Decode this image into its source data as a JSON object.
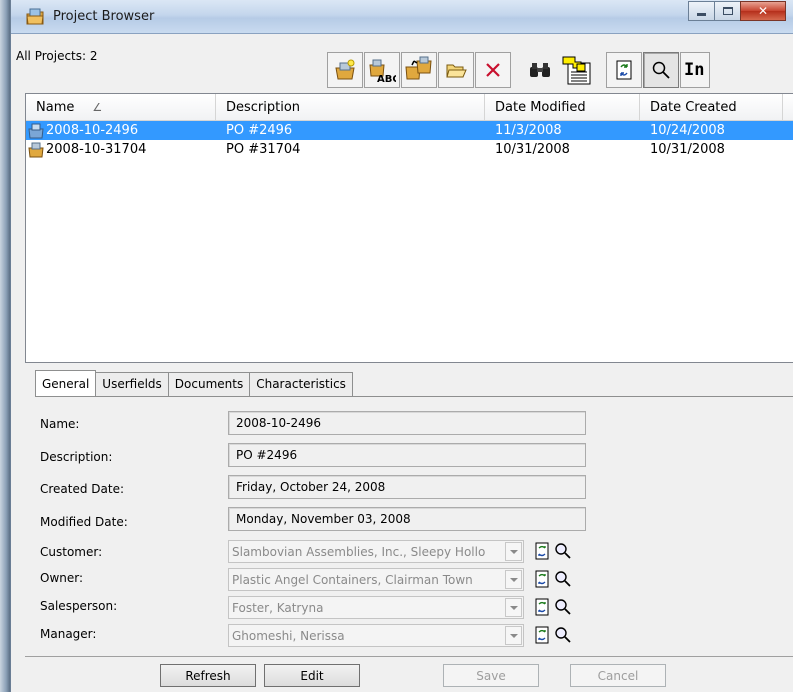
{
  "window": {
    "title": "Project Browser"
  },
  "summary": {
    "all_projects": "All Projects: 2"
  },
  "toolbar": {
    "buttons": [
      "new-project-icon",
      "rename-project-icon",
      "copy-project-icon",
      "open-folder-icon",
      "delete-icon",
      "find-binoculars-icon",
      "map-report-icon",
      "refresh-icon",
      "search-icon"
    ],
    "overflow_label": "In"
  },
  "list": {
    "columns": [
      "Name",
      "Description",
      "Date Modified",
      "Date Created"
    ],
    "rows": [
      {
        "name": "2008-10-2496",
        "description": "PO #2496",
        "modified": "11/3/2008",
        "created": "10/24/2008",
        "selected": true
      },
      {
        "name": "2008-10-31704",
        "description": "PO #31704",
        "modified": "10/31/2008",
        "created": "10/31/2008",
        "selected": false
      }
    ]
  },
  "tabs": [
    "General",
    "Userfields",
    "Documents",
    "Characteristics"
  ],
  "active_tab": "General",
  "form": {
    "name_label": "Name:",
    "name_value": "2008-10-2496",
    "description_label": "Description:",
    "description_value": "PO #2496",
    "created_label": "Created Date:",
    "created_value": "Friday, October 24, 2008",
    "modified_label": "Modified Date:",
    "modified_value": "Monday, November 03, 2008",
    "customer_label": "Customer:",
    "customer_value": "Slambovian Assemblies, Inc., Sleepy Hollo",
    "owner_label": "Owner:",
    "owner_value": "Plastic Angel Containers, Clairman Town",
    "salesperson_label": "Salesperson:",
    "salesperson_value": "Foster, Katryna",
    "manager_label": "Manager:",
    "manager_value": "Ghomeshi, Nerissa"
  },
  "buttons": {
    "refresh": "Refresh",
    "edit": "Edit",
    "save": "Save",
    "cancel": "Cancel"
  },
  "colors": {
    "selection": "#3399ff",
    "window_bg": "#f0f0f0",
    "title_bar": "#c4d6ec"
  }
}
